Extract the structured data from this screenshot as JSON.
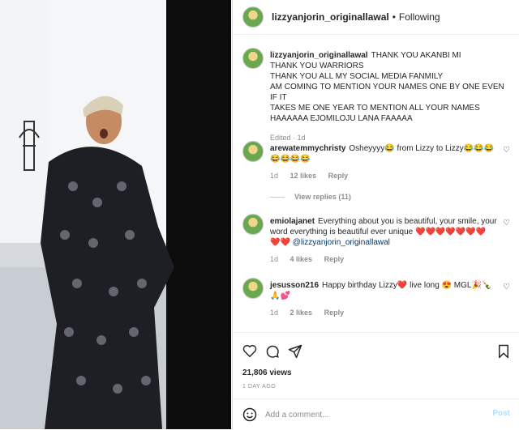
{
  "post_image": {
    "subject": "woman-in-black-patterned-gown"
  },
  "header": {
    "username": "lizzyanjorin_originallawal",
    "separator": "•",
    "follow_status": "Following"
  },
  "caption": {
    "username": "lizzyanjorin_originallawal",
    "lines": [
      "THANK YOU AKANBI MI",
      "THANK YOU WARRIORS",
      "THANK YOU ALL MY SOCIAL MEDIA FANMILY",
      "AM COMING TO MENTION YOUR NAMES ONE BY ONE EVEN IF IT",
      "TAKES ME ONE YEAR TO MENTION ALL YOUR NAMES",
      "HAAAAAA EJOMILOJU LANA FAAAAA"
    ],
    "edited": "Edited · 1d"
  },
  "comments": [
    {
      "username": "arewatemmychristy",
      "text_line1": "Osheyyyy😂  from Lizzy to Lizzy😂😂😂",
      "text_line2": "😂😂😂😂",
      "time": "1d",
      "likes": "12 likes",
      "reply": "Reply",
      "view_replies": "View replies (11)"
    },
    {
      "username": "emiolajanet",
      "text_line1": "Everything about you is beautiful, your smile, your",
      "text_line2": "word everything is beautiful ever unique ❤️❤️❤️❤️❤️❤️❤️",
      "text_line3": "❤️❤️",
      "mention": "@lizzyanjorin_originallawal",
      "time": "1d",
      "likes": "4 likes",
      "reply": "Reply"
    },
    {
      "username": "jesusson216",
      "text_line1": "Happy birthday Lizzy❤️ live long 😍 MGL🎉🍾",
      "text_line2": "🙏💕",
      "time": "1d",
      "likes": "2 likes",
      "reply": "Reply"
    }
  ],
  "stats": {
    "views": "21,806 views",
    "age": "1 DAY AGO"
  },
  "add_comment": {
    "placeholder": "Add a comment...",
    "post_label": "Post"
  },
  "colors": {
    "link": "#00376b",
    "muted": "#8e8e8e",
    "post_disabled": "#b2dffc"
  }
}
